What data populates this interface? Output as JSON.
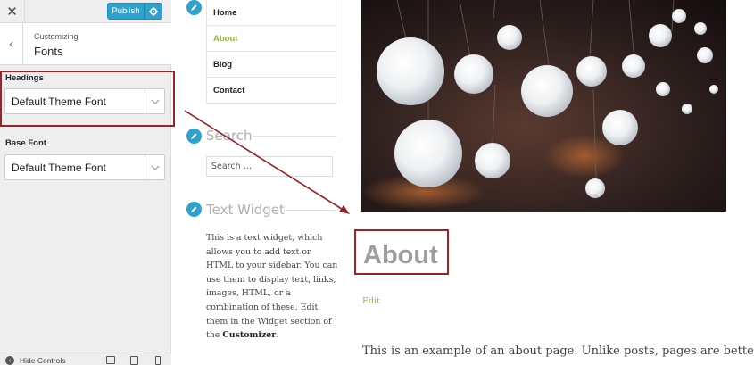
{
  "customizer": {
    "close_label": "✕",
    "publish_label": "Publish",
    "back_label": "‹",
    "breadcrumb": "Customizing",
    "section_title": "Fonts",
    "headings_label": "Headings",
    "headings_value": "Default Theme Font",
    "base_font_label": "Base Font",
    "base_font_value": "Default Theme Font",
    "hide_controls": "Hide Controls"
  },
  "preview": {
    "menu": [
      "Home",
      "About",
      "Blog",
      "Contact"
    ],
    "active_menu": "About",
    "search_title": "Search",
    "search_placeholder": "Search …",
    "text_widget_title": "Text Widget",
    "text_widget_body": "This is a text widget, which allows you to add text or HTML to your sidebar. You can use them to display text, links, images, HTML, or a combination of these. Edit them in the Widget section of the",
    "text_widget_link": "Customizer",
    "text_widget_end": ".",
    "page_title": "About",
    "edit_link": "Edit",
    "intro": "This is an example of an about page. Unlike posts, pages are better"
  },
  "colors": {
    "accent": "#2ea2cc",
    "link_green": "#8cba2d",
    "annotation_red": "#9b2226"
  },
  "icons": [
    "close-icon",
    "gear-icon",
    "chevron-left-icon",
    "chevron-down-icon",
    "pencil-icon",
    "eye-icon",
    "desktop-icon",
    "tablet-icon",
    "mobile-icon"
  ]
}
